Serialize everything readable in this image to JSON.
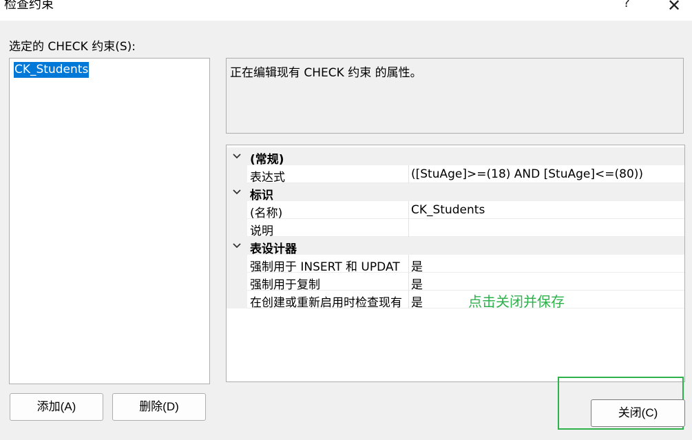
{
  "window": {
    "title": "检查约束",
    "help_label": "?",
    "close_label": "✕"
  },
  "list": {
    "caption": "选定的 CHECK 约束(S):",
    "items": [
      "CK_Students"
    ]
  },
  "description": "正在编辑现有 CHECK 约束 的属性。",
  "grid": {
    "categories": [
      {
        "label": "(常规)",
        "props": [
          {
            "name": "表达式",
            "value": "([StuAge]>=(18) AND [StuAge]<=(80))"
          }
        ]
      },
      {
        "label": "标识",
        "props": [
          {
            "name": "(名称)",
            "value": "CK_Students"
          },
          {
            "name": "说明",
            "value": ""
          }
        ]
      },
      {
        "label": "表设计器",
        "props": [
          {
            "name": "强制用于 INSERT 和 UPDAT",
            "value": "是"
          },
          {
            "name": "强制用于复制",
            "value": "是"
          },
          {
            "name": "在创建或重新启用时检查现有",
            "value": "是"
          }
        ]
      }
    ]
  },
  "annotation": "点击关闭并保存",
  "buttons": {
    "add": "添加(A)",
    "delete": "删除(D)",
    "close": "关闭(C)"
  },
  "colors": {
    "selection": "#0078d7",
    "annotation": "#2db24b"
  }
}
